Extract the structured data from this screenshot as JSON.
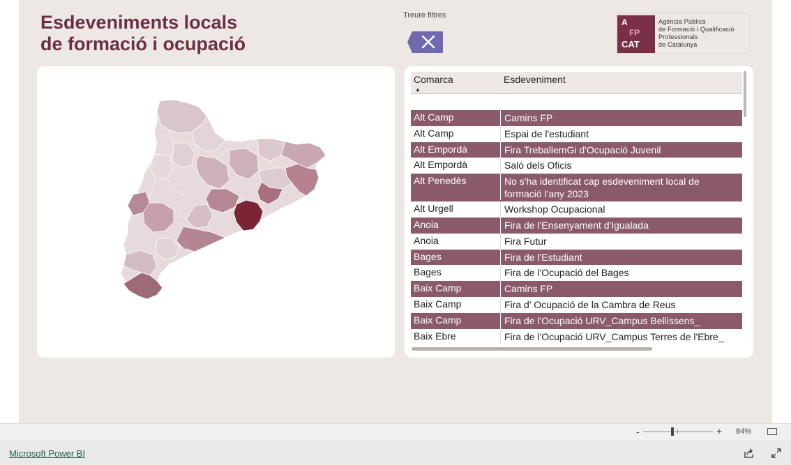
{
  "title": {
    "line1": "Esdeveniments locals",
    "line2": "de formació i ocupació"
  },
  "filters": {
    "label": "Treure filtres",
    "clear_icon": "close-icon"
  },
  "logo": {
    "mark_letters": [
      "A",
      "FP",
      "CAT"
    ],
    "text_lines": [
      "Agència Pública",
      "de Formació i Qualificació",
      "Professionals",
      "de Catalunya"
    ]
  },
  "table": {
    "columns": [
      "Comarca",
      "Esdeveniment"
    ],
    "sort_indicator": "▲",
    "rows": [
      {
        "comarca": "Alt Camp",
        "esdeveniment": "Camins FP",
        "highlight": true
      },
      {
        "comarca": "Alt Camp",
        "esdeveniment": "Espai de l'estudiant",
        "highlight": false
      },
      {
        "comarca": "Alt Empordà",
        "esdeveniment": "Fira TreballemGi d'Ocupació Juvenil",
        "highlight": true
      },
      {
        "comarca": "Alt Empordà",
        "esdeveniment": "Saló dels Oficis",
        "highlight": false
      },
      {
        "comarca": "Alt Penedès",
        "esdeveniment": "No s'ha identificat cap esdeveniment local de formació l'any 2023",
        "highlight": true
      },
      {
        "comarca": "Alt Urgell",
        "esdeveniment": "Workshop Ocupacional",
        "highlight": false
      },
      {
        "comarca": "Anoia",
        "esdeveniment": "Fira de l'Ensenyament d'Igualada",
        "highlight": true
      },
      {
        "comarca": "Anoia",
        "esdeveniment": "Fira Futur",
        "highlight": false
      },
      {
        "comarca": "Bages",
        "esdeveniment": "Fira de l'Estudiant",
        "highlight": true
      },
      {
        "comarca": "Bages",
        "esdeveniment": "Fira de l'Ocupació del Bages",
        "highlight": false
      },
      {
        "comarca": "Baix Camp",
        "esdeveniment": "Camins FP",
        "highlight": true
      },
      {
        "comarca": "Baix Camp",
        "esdeveniment": "Fira d’ Ocupació de la Cambra de Reus",
        "highlight": false
      },
      {
        "comarca": "Baix Camp",
        "esdeveniment": "Fira de l'Ocupació URV_Campus Bellissens_",
        "highlight": true
      },
      {
        "comarca": "Baix Ebre",
        "esdeveniment": "Fira de l'Ocupació URV_Campus Terres de l'Ebre_",
        "highlight": false
      }
    ]
  },
  "zoom": {
    "minus": "-",
    "plus": "+",
    "value": "84%",
    "level_percent": 84
  },
  "footer": {
    "link": "Microsoft Power BI"
  },
  "colors": {
    "accent": "#6b2f48",
    "row_highlight": "#8a5a6a",
    "canvas": "#ede8e4",
    "button": "#6f6aad"
  }
}
